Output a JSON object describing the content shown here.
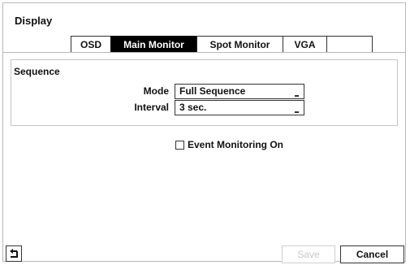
{
  "window": {
    "title": "Display"
  },
  "tabs": [
    {
      "label": "OSD",
      "active": false
    },
    {
      "label": "Main Monitor",
      "active": true
    },
    {
      "label": "Spot Monitor",
      "active": false
    },
    {
      "label": "VGA",
      "active": false
    },
    {
      "label": "",
      "active": false
    }
  ],
  "sequence": {
    "title": "Sequence",
    "mode_label": "Mode",
    "mode_value": "Full Sequence",
    "interval_label": "Interval",
    "interval_value": "3 sec."
  },
  "event_monitoring": {
    "label": "Event Monitoring On",
    "checked": false
  },
  "buttons": {
    "back_icon": "back-arrow-icon",
    "save_label": "Save",
    "cancel_label": "Cancel"
  },
  "colors": {
    "active_tab_bg": "#000000",
    "disabled_text": "#c8c8c8"
  }
}
